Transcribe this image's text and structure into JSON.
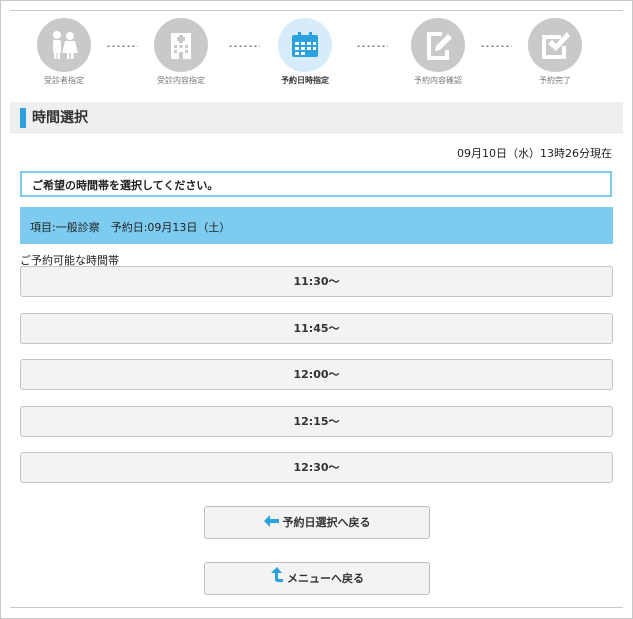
{
  "steps": [
    {
      "label": "受診者指定",
      "icon": "people-icon"
    },
    {
      "label": "受診内容指定",
      "icon": "hospital-icon"
    },
    {
      "label": "予約日時指定",
      "icon": "calendar-icon"
    },
    {
      "label": "予約内容確認",
      "icon": "edit-icon"
    },
    {
      "label": "予約完了",
      "icon": "checkbox-icon"
    }
  ],
  "active_step": 2,
  "colors": {
    "accent": "#2aa2df",
    "info_bar": "#7dccf0",
    "notice_border": "#7fcbe9",
    "step_inactive": "#c9c9c9",
    "step_active": "#d6ecfa"
  },
  "section": {
    "title": "時間選択"
  },
  "current_time": "09月10日（水）13時26分現在",
  "notice": "ご希望の時間帯を選択してください。",
  "info": "項目:一般診察　予約日:09月13日（土）",
  "available_label": "ご予約可能な時間帯",
  "slots": [
    "11:30〜",
    "11:45〜",
    "12:00〜",
    "12:15〜",
    "12:30〜"
  ],
  "buttons": {
    "back_date": "予約日選択へ戻る",
    "back_menu": "メニューへ戻る"
  }
}
